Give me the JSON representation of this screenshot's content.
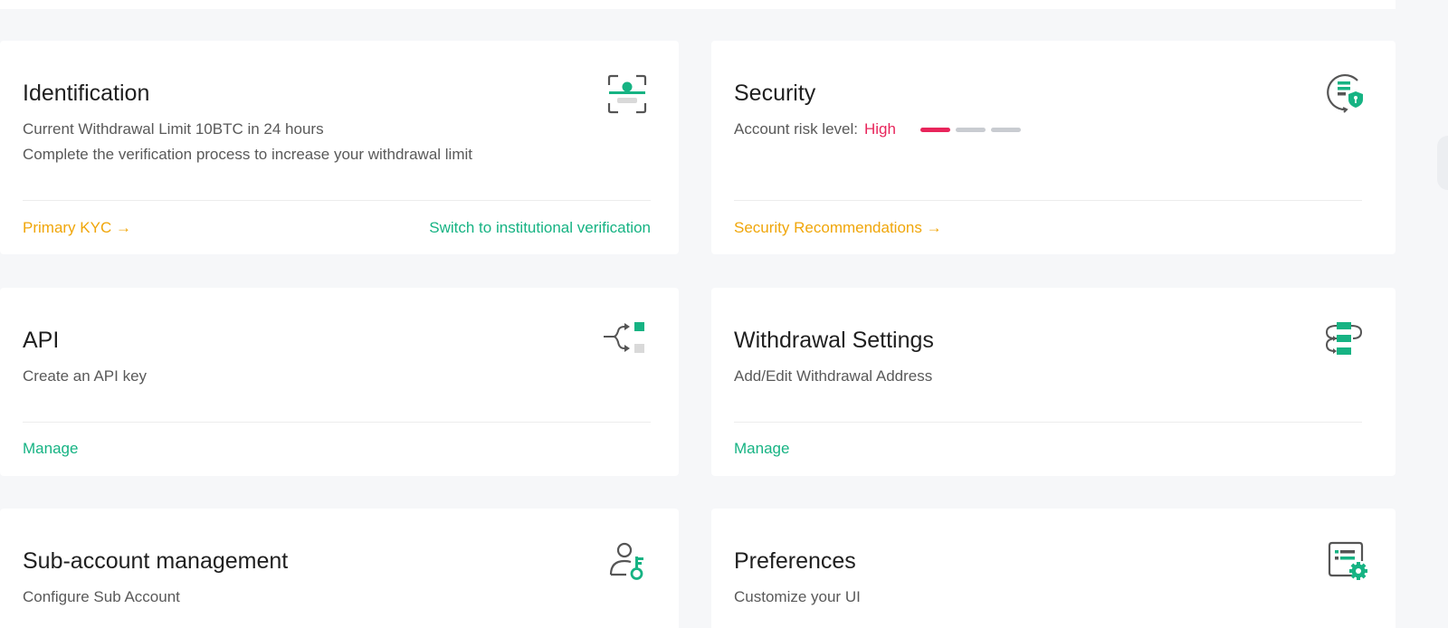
{
  "colors": {
    "accent_green": "#16b383",
    "accent_orange": "#f0a60a",
    "risk_high": "#e8255b",
    "risk_off": "#c9ccd1"
  },
  "identification": {
    "title": "Identification",
    "line1": "Current Withdrawal Limit 10BTC in 24 hours",
    "line2": "Complete the verification process to increase your withdrawal limit",
    "primary_link": "Primary KYC →",
    "secondary_link": "Switch to institutional verification",
    "icon": "face-scan-icon"
  },
  "security": {
    "title": "Security",
    "risk_label": "Account risk level:",
    "risk_value": "High",
    "risk_level": 1,
    "risk_levels_total": 3,
    "link": "Security Recommendations →",
    "icon": "shield-document-icon"
  },
  "api": {
    "title": "API",
    "desc": "Create an API key",
    "link": "Manage",
    "icon": "api-branch-icon"
  },
  "withdrawal": {
    "title": "Withdrawal Settings",
    "desc": "Add/Edit Withdrawal Address",
    "link": "Manage",
    "icon": "withdrawal-flow-icon"
  },
  "subaccount": {
    "title": "Sub-account management",
    "desc": "Configure Sub Account",
    "icon": "user-key-icon"
  },
  "preferences": {
    "title": "Preferences",
    "desc": "Customize your UI",
    "icon": "settings-document-icon"
  }
}
